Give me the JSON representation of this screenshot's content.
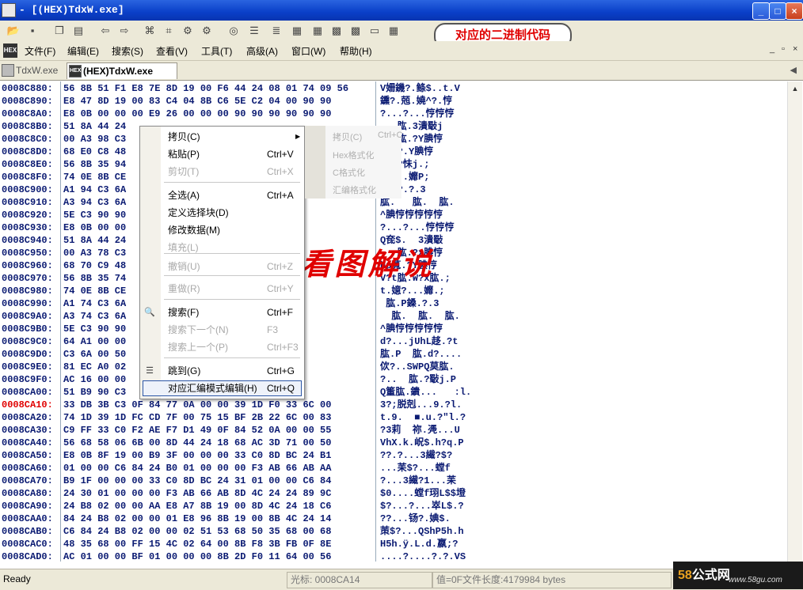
{
  "window": {
    "title": "- [(HEX)TdxW.exe]"
  },
  "annotation": "对应的二进制代码",
  "menubar": {
    "items": [
      "文件(F)",
      "编辑(E)",
      "搜索(S)",
      "查看(V)",
      "工具(T)",
      "高级(A)",
      "窗口(W)",
      "帮助(H)"
    ],
    "mdi_controls": [
      "_",
      "▫",
      "×"
    ]
  },
  "tabs": [
    {
      "label": "TdxW.exe",
      "active": false
    },
    {
      "label": "(HEX)TdxW.exe",
      "active": true
    }
  ],
  "hex_rows": [
    {
      "addr": "0008C880:",
      "hex": "56 8B 51 F1 E8 7E 8D 19 00 F6 44 24 08 01 74 09 56",
      "asc": "V姍鐖?.鲦$..t.V"
    },
    {
      "addr": "0008C890:",
      "hex": "E8 47 8D 19 00 83 C4 04 8B C6 5E C2 04 00 90 90",
      "asc": "鑂?.兡.嬈^?.悙"
    },
    {
      "addr": "0008C8A0:",
      "hex": "E8 0B 00 00 00 E9 26 00 00 00 90 90 90 90 90 90",
      "asc": "?...?...悙悙悙"
    },
    {
      "addr": "0008C8B0:",
      "hex": "51 8A 44 24",
      "asc": "   肱.3潰斀j"
    },
    {
      "addr": "0008C8C0:",
      "hex": "00 A3 98 C3",
      "asc": "   肱.?Y腆悙"
    },
    {
      "addr": "0008C8D0:",
      "hex": "68 E0 C8 48",
      "asc": "   ?.Y腆悙"
    },
    {
      "addr": "0008C8E0:",
      "hex": "56 8B 35 94",
      "asc": "   ?怽j.;"
    },
    {
      "addr": "0008C8F0:",
      "hex": "74 0E 8B CE",
      "asc": "   ..孊P;"
    },
    {
      "addr": "0008C900:",
      "hex": "A1 94 C3 6A",
      "asc": "   ?.?.3"
    },
    {
      "addr": "0008C910:",
      "hex": "A3 94 C3 6A",
      "asc": "肱.   肱.  肱."
    },
    {
      "addr": "0008C920:",
      "hex": "5E C3 90 90",
      "asc": "^腆悙悙悙悙悙"
    },
    {
      "addr": "0008C930:",
      "hex": "E8 0B 00 00",
      "asc": "?...?...悙悙悙"
    },
    {
      "addr": "0008C940:",
      "hex": "51 8A 44 24",
      "asc": "Q奃$.  3潰斀"
    },
    {
      "addr": "0008C950:",
      "hex": "00 A3 78 C3",
      "asc": "   肱.?x腆悙"
    },
    {
      "addr": "0008C960:",
      "hex": "68 70 C9 48",
      "asc": "hp萈.?Y腆悙"
    },
    {
      "addr": "0008C970:",
      "hex": "56 8B 35 74",
      "asc": "V?t肱.W?x肱.;"
    },
    {
      "addr": "0008C980:",
      "hex": "74 0E 8B CE",
      "asc": "t.嬑?...孊.;"
    },
    {
      "addr": "0008C990:",
      "hex": "A1 74 C3 6A",
      "asc": " 肱.P鎟.?.3"
    },
    {
      "addr": "0008C9A0:",
      "hex": "A3 74 C3 6A",
      "asc": "  肱.  肱.  肱."
    },
    {
      "addr": "0008C9B0:",
      "hex": "5E C3 90 90",
      "asc": "^腆悙悙悙悙悙"
    },
    {
      "addr": "0008C9C0:",
      "hex": "64 A1 00 00",
      "asc": "d?...jUhL趍.?t"
    },
    {
      "addr": "0008C9D0:",
      "hex": "C3 6A 00 50",
      "asc": "肱.P  肱.d?...."
    },
    {
      "addr": "0008C9E0:",
      "hex": "81 EC A0 02",
      "asc": "佽?..SWPQ莫肱."
    },
    {
      "addr": "0008C9F0:",
      "hex": "AC 16 00 00",
      "asc": "?..  肱.?斀j.P"
    },
    {
      "addr": "0008CA00:",
      "hex": "51 B9 90 C3",
      "asc": "Q箽肱.鐀...   :l."
    },
    {
      "addr": "0008CA10:",
      "hex": "33 DB 3B C3 0F 84 77 0A 00 00 39 1D F0 33 6C 00",
      "asc": "3?;脱剋...9.?l."
    },
    {
      "addr": "0008CA20:",
      "hex": "74 1D 39 1D FC CD 7F 00 75 15 BF 2B 22 6C 00 83",
      "asc": "t.9.  ■.u.?\"l.?"
    },
    {
      "addr": "0008CA30:",
      "hex": "C9 FF 33 C0 F2 AE F7 D1 49 0F 84 52 0A 00 00 55",
      "asc": "?3莉  祢.凴...U"
    },
    {
      "addr": "0008CA40:",
      "hex": "56 68 58 06 6B 00 8D 44 24 18 68 AC 3D 71 00 50",
      "asc": "VhX.k.岲$.h?q.P"
    },
    {
      "addr": "0008CA50:",
      "hex": "E8 0B 8F 19 00 B9 3F 00 00 00 33 C0 8D BC 24 B1",
      "asc": "??.?...3繊?$?"
    },
    {
      "addr": "0008CA60:",
      "hex": "01 00 00 C6 84 24 B0 01 00 00 00 F3 AB 66 AB AA",
      "asc": "...苿$?...螳f"
    },
    {
      "addr": "0008CA70:",
      "hex": "B9 1F 00 00 00 33 C0 8D BC 24 31 01 00 00 C6 84",
      "asc": "?...3繊?1...苿"
    },
    {
      "addr": "0008CA80:",
      "hex": "24 30 01 00 00 00 F3 AB 66 AB 8D 4C 24 24 89 9C",
      "asc": "$0....螳f珝L$$墱"
    },
    {
      "addr": "0008CA90:",
      "hex": "24 B8 02 00 00 AA E8 A7 8B 19 00 8D 4C 24 18 C6",
      "asc": "$?...?...崒L$.?"
    },
    {
      "addr": "0008CAA0:",
      "hex": "84 24 B8 02 00 00 01 E8 96 8B 19 00 8B 4C 24 14",
      "asc": "??...钖?.婰$."
    },
    {
      "addr": "0008CAB0:",
      "hex": "C6 84 24 B8 02 00 00 02 51 53 68 50 35 68 00 68",
      "asc": "茦$?...QShP5h.h"
    },
    {
      "addr": "0008CAC0:",
      "hex": "48 35 68 00 FF 15 4C 02 64 00 8B F8 3B FB 0F 8E",
      "asc": "H5h.ÿ.L.d.嬴;?"
    },
    {
      "addr": "0008CAD0:",
      "hex": "AC 01 00 00 BF 01 00 00 00 8B 2D F0 11 64 00 56",
      "asc": "....?....?.?.VS"
    }
  ],
  "context_menu": {
    "items": [
      {
        "label": "拷贝(C)",
        "shortcut": "",
        "disabled": false,
        "submenu": true
      },
      {
        "label": "粘贴(P)",
        "shortcut": "Ctrl+V",
        "disabled": false
      },
      {
        "label": "剪切(T)",
        "shortcut": "Ctrl+X",
        "disabled": true
      },
      {
        "label": "全选(A)",
        "shortcut": "Ctrl+A",
        "disabled": false
      },
      {
        "label": "定义选择块(D)",
        "shortcut": "",
        "disabled": false
      },
      {
        "label": "修改数据(M)",
        "shortcut": "",
        "disabled": false
      },
      {
        "label": "填充(L)",
        "shortcut": "",
        "disabled": true
      },
      {
        "label": "撤销(U)",
        "shortcut": "Ctrl+Z",
        "disabled": true
      },
      {
        "label": "重做(R)",
        "shortcut": "Ctrl+Y",
        "disabled": true
      },
      {
        "label": "搜索(F)",
        "shortcut": "Ctrl+F",
        "disabled": false
      },
      {
        "label": "搜索下一个(N)",
        "shortcut": "F3",
        "disabled": true
      },
      {
        "label": "搜索上一个(P)",
        "shortcut": "Ctrl+F3",
        "disabled": true
      },
      {
        "label": "跳到(G)",
        "shortcut": "Ctrl+G",
        "disabled": false
      },
      {
        "label": "对应汇编模式编辑(H)",
        "shortcut": "Ctrl+Q",
        "disabled": false,
        "highlighted": true
      }
    ]
  },
  "submenu": {
    "shortcut": "Ctrl+C",
    "items": [
      "拷贝(C)",
      "Hex格式化",
      "C格式化",
      "汇编格式化"
    ]
  },
  "calligraphy": "经典论坛  看图解说",
  "status": {
    "ready": "Ready",
    "cursor": "光标: 0008CA14",
    "value": "值=0F文件长度:4179984 bytes"
  },
  "watermark": {
    "brand_num": "58",
    "brand_text": "公式网",
    "url": "www.58gu.com"
  }
}
